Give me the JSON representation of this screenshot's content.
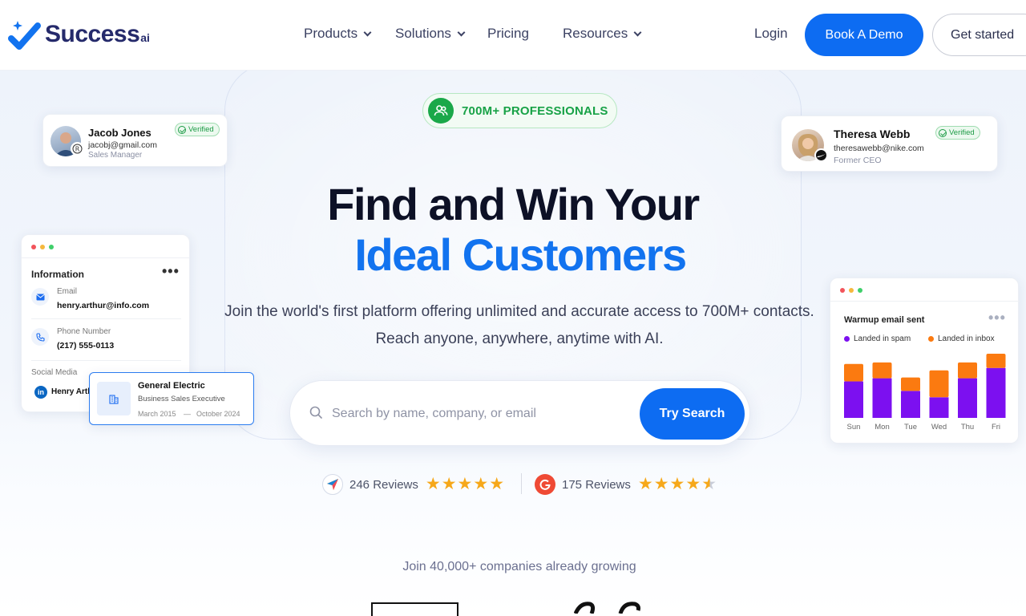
{
  "nav": {
    "logo_text": "Success",
    "logo_suffix": "ai",
    "menu": [
      {
        "label": "Products",
        "dropdown": true
      },
      {
        "label": "Solutions",
        "dropdown": true
      },
      {
        "label": "Pricing",
        "dropdown": false
      },
      {
        "label": "Resources",
        "dropdown": true
      }
    ],
    "login": "Login",
    "book_demo": "Book A Demo",
    "get_started": "Get started"
  },
  "hero": {
    "badge": "700M+ PROFESSIONALS",
    "title_line1": "Find and Win Your",
    "title_line2": "Ideal Customers",
    "subtitle_line1": "Join the world's first platform offering unlimited and accurate access to 700M+ contacts.",
    "subtitle_line2": "Reach anyone, anywhere, anytime with AI.",
    "search_placeholder": "Search by name, company, or email",
    "search_button": "Try Search"
  },
  "reviews": [
    {
      "text": "246 Reviews",
      "rating": 5
    },
    {
      "text": "175 Reviews",
      "rating": 4.5
    }
  ],
  "join_text": "Join 40,000+ companies already growing",
  "cards": {
    "jacob": {
      "name": "Jacob Jones",
      "email": "jacobj@gmail.com",
      "role": "Sales Manager",
      "badge": "Verified"
    },
    "theresa": {
      "name": "Theresa Webb",
      "email": "theresawebb@nike.com",
      "role": "Former CEO",
      "badge": "Verified"
    },
    "info": {
      "title": "Information",
      "email_label": "Email",
      "email_value": "henry.arthur@info.com",
      "phone_label": "Phone Number",
      "phone_value": "(217) 555-0113",
      "social_label": "Social Media",
      "social_value": "Henry Arthur"
    },
    "company": {
      "name": "General Electric",
      "role": "Business Sales Executive",
      "start": "March 2015",
      "dash": "—",
      "end": "October 2024"
    }
  },
  "chart_data": {
    "type": "bar",
    "title": "Warmup email sent",
    "categories": [
      "Sun",
      "Mon",
      "Tue",
      "Wed",
      "Thu",
      "Fri"
    ],
    "series": [
      {
        "name": "Landed in spam",
        "color": "#7c10f0",
        "values": [
          46,
          50,
          34,
          26,
          50,
          63
        ]
      },
      {
        "name": "Landed in inbox",
        "color": "#fb7a10",
        "values": [
          22,
          20,
          17,
          34,
          20,
          18
        ]
      }
    ],
    "stacked": true,
    "ylim": [
      0,
      85
    ]
  },
  "colors": {
    "brand": "#0d6cf2",
    "accent_green": "#18a247",
    "star": "#f6a81a"
  }
}
